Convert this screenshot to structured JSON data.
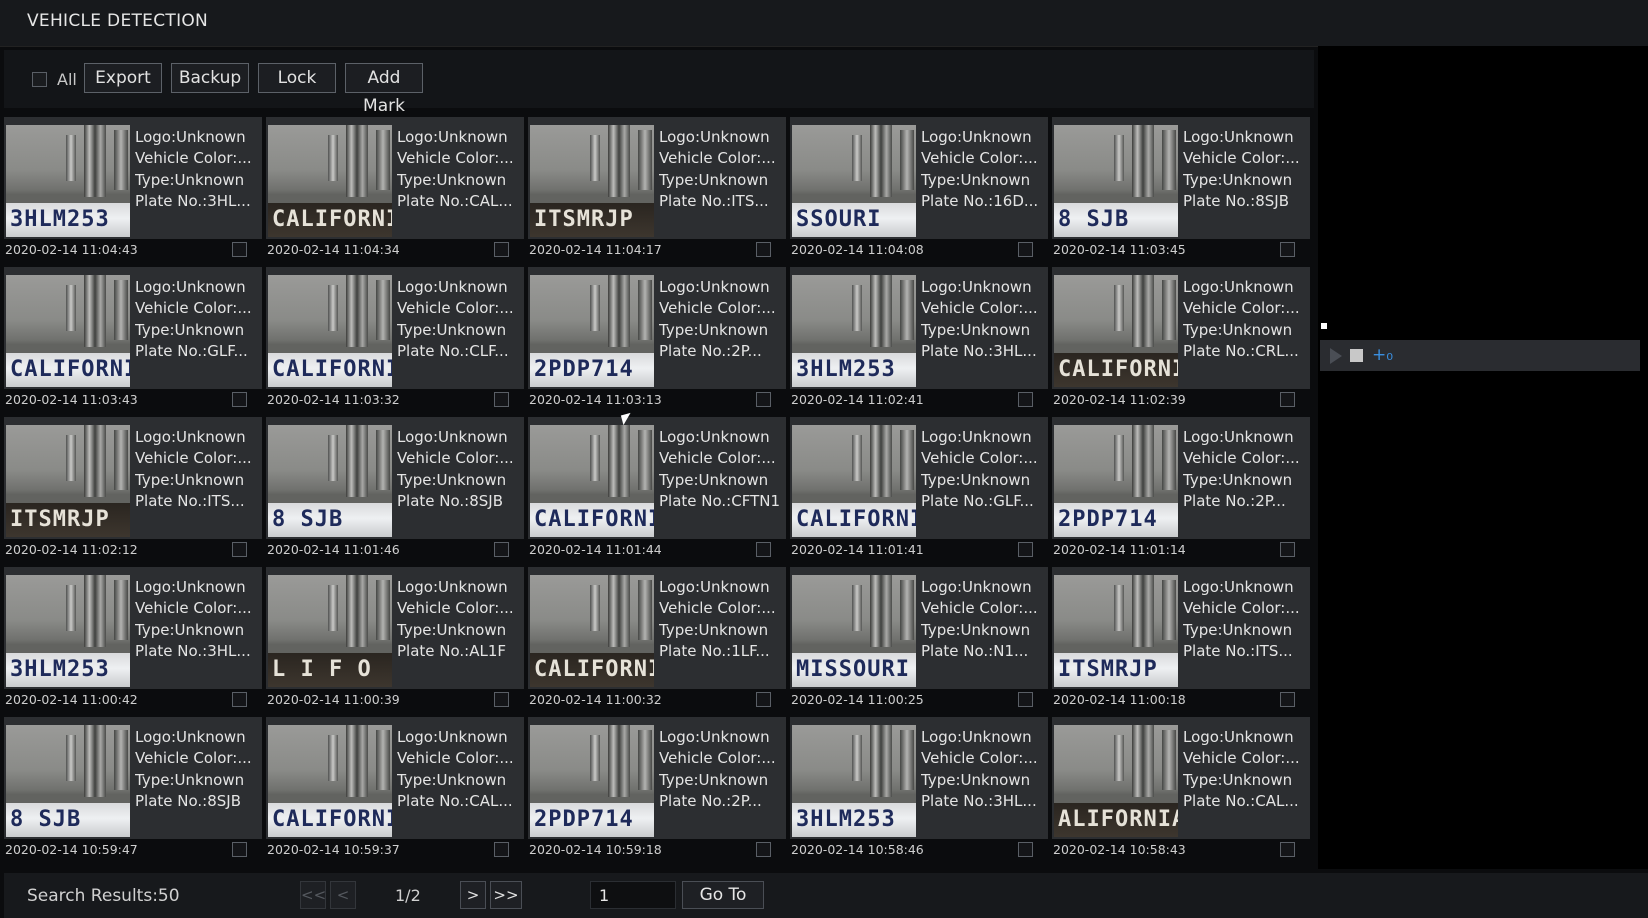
{
  "window": {
    "title": "VEHICLE DETECTION"
  },
  "toolbar": {
    "all_label": "All",
    "export_label": "Export",
    "backup_label": "Backup",
    "lock_label": "Lock",
    "add_mark_label": "Add Mark"
  },
  "records": [
    {
      "logo": "Logo:Unknown",
      "color": "Vehicle Color:...",
      "type": "Type:Unknown",
      "plate": "Plate No.:3HL...",
      "time": "2020-02-14 11:04:43",
      "plate_img": "3HLM253",
      "dark": false
    },
    {
      "logo": "Logo:Unknown",
      "color": "Vehicle Color:...",
      "type": "Type:Unknown",
      "plate": "Plate No.:CAL...",
      "time": "2020-02-14 11:04:34",
      "plate_img": "CALIFORNIA",
      "dark": true
    },
    {
      "logo": "Logo:Unknown",
      "color": "Vehicle Color:...",
      "type": "Type:Unknown",
      "plate": "Plate No.:ITS...",
      "time": "2020-02-14 11:04:17",
      "plate_img": "ITSMRJP",
      "dark": true
    },
    {
      "logo": "Logo:Unknown",
      "color": "Vehicle Color:...",
      "type": "Type:Unknown",
      "plate": "Plate No.:16D...",
      "time": "2020-02-14 11:04:08",
      "plate_img": "SSOURI",
      "dark": false
    },
    {
      "logo": "Logo:Unknown",
      "color": "Vehicle Color:...",
      "type": "Type:Unknown",
      "plate": "Plate No.:8SJB",
      "time": "2020-02-14 11:03:45",
      "plate_img": "8 SJB",
      "dark": false
    },
    {
      "logo": "Logo:Unknown",
      "color": "Vehicle Color:...",
      "type": "Type:Unknown",
      "plate": "Plate No.:GLF...",
      "time": "2020-02-14 11:03:43",
      "plate_img": "CALIFORNIA",
      "dark": false
    },
    {
      "logo": "Logo:Unknown",
      "color": "Vehicle Color:...",
      "type": "Type:Unknown",
      "plate": "Plate No.:CLF...",
      "time": "2020-02-14 11:03:32",
      "plate_img": "CALIFORNIA",
      "dark": false
    },
    {
      "logo": "Logo:Unknown",
      "color": "Vehicle Color:...",
      "type": "Type:Unknown",
      "plate": "Plate No.:2P...",
      "time": "2020-02-14 11:03:13",
      "plate_img": "2PDP714",
      "dark": false
    },
    {
      "logo": "Logo:Unknown",
      "color": "Vehicle Color:...",
      "type": "Type:Unknown",
      "plate": "Plate No.:3HL...",
      "time": "2020-02-14 11:02:41",
      "plate_img": "3HLM253",
      "dark": false
    },
    {
      "logo": "Logo:Unknown",
      "color": "Vehicle Color:...",
      "type": "Type:Unknown",
      "plate": "Plate No.:CRL...",
      "time": "2020-02-14 11:02:39",
      "plate_img": "CALIFORNIA",
      "dark": true
    },
    {
      "logo": "Logo:Unknown",
      "color": "Vehicle Color:...",
      "type": "Type:Unknown",
      "plate": "Plate No.:ITS...",
      "time": "2020-02-14 11:02:12",
      "plate_img": "ITSMRJP",
      "dark": true
    },
    {
      "logo": "Logo:Unknown",
      "color": "Vehicle Color:...",
      "type": "Type:Unknown",
      "plate": "Plate No.:8SJB",
      "time": "2020-02-14 11:01:46",
      "plate_img": "8 SJB",
      "dark": false
    },
    {
      "logo": "Logo:Unknown",
      "color": "Vehicle Color:...",
      "type": "Type:Unknown",
      "plate": "Plate No.:CFTN1",
      "time": "2020-02-14 11:01:44",
      "plate_img": "CALIFORNIA",
      "dark": false
    },
    {
      "logo": "Logo:Unknown",
      "color": "Vehicle Color:...",
      "type": "Type:Unknown",
      "plate": "Plate No.:GLF...",
      "time": "2020-02-14 11:01:41",
      "plate_img": "CALIFORNIA",
      "dark": false
    },
    {
      "logo": "Logo:Unknown",
      "color": "Vehicle Color:...",
      "type": "Type:Unknown",
      "plate": "Plate No.:2P...",
      "time": "2020-02-14 11:01:14",
      "plate_img": "2PDP714",
      "dark": false
    },
    {
      "logo": "Logo:Unknown",
      "color": "Vehicle Color:...",
      "type": "Type:Unknown",
      "plate": "Plate No.:3HL...",
      "time": "2020-02-14 11:00:42",
      "plate_img": "3HLM253",
      "dark": false
    },
    {
      "logo": "Logo:Unknown",
      "color": "Vehicle Color:...",
      "type": "Type:Unknown",
      "plate": "Plate No.:AL1F",
      "time": "2020-02-14 11:00:39",
      "plate_img": "L I F O",
      "dark": true
    },
    {
      "logo": "Logo:Unknown",
      "color": "Vehicle Color:...",
      "type": "Type:Unknown",
      "plate": "Plate No.:1LF...",
      "time": "2020-02-14 11:00:32",
      "plate_img": "CALIFORNIA",
      "dark": true
    },
    {
      "logo": "Logo:Unknown",
      "color": "Vehicle Color:...",
      "type": "Type:Unknown",
      "plate": "Plate No.:N1...",
      "time": "2020-02-14 11:00:25",
      "plate_img": "MISSOURI",
      "dark": false
    },
    {
      "logo": "Logo:Unknown",
      "color": "Vehicle Color:...",
      "type": "Type:Unknown",
      "plate": "Plate No.:ITS...",
      "time": "2020-02-14 11:00:18",
      "plate_img": "ITSMRJP",
      "dark": false
    },
    {
      "logo": "Logo:Unknown",
      "color": "Vehicle Color:...",
      "type": "Type:Unknown",
      "plate": "Plate No.:8SJB",
      "time": "2020-02-14 10:59:47",
      "plate_img": "8 SJB",
      "dark": false
    },
    {
      "logo": "Logo:Unknown",
      "color": "Vehicle Color:...",
      "type": "Type:Unknown",
      "plate": "Plate No.:CAL...",
      "time": "2020-02-14 10:59:37",
      "plate_img": "CALIFORNIA",
      "dark": false
    },
    {
      "logo": "Logo:Unknown",
      "color": "Vehicle Color:...",
      "type": "Type:Unknown",
      "plate": "Plate No.:2P...",
      "time": "2020-02-14 10:59:18",
      "plate_img": "2PDP714",
      "dark": false
    },
    {
      "logo": "Logo:Unknown",
      "color": "Vehicle Color:...",
      "type": "Type:Unknown",
      "plate": "Plate No.:3HL...",
      "time": "2020-02-14 10:58:46",
      "plate_img": "3HLM253",
      "dark": false
    },
    {
      "logo": "Logo:Unknown",
      "color": "Vehicle Color:...",
      "type": "Type:Unknown",
      "plate": "Plate No.:CAL...",
      "time": "2020-02-14 10:58:43",
      "plate_img": "ALIFORNIA",
      "dark": true
    }
  ],
  "player": {
    "play_icon": "play-icon",
    "stop_icon": "stop-icon",
    "clip_icon": "clip-icon",
    "clip_glyph": "+₀"
  },
  "footer": {
    "search_results": "Search Results:50",
    "first_label": "<<",
    "prev_label": "<",
    "page_indicator": "1/2",
    "next_label": ">",
    "last_label": ">>",
    "page_input_value": "1",
    "goto_label": "Go To"
  },
  "colors": {
    "background": "#0b0c0e",
    "card": "#2c2e31",
    "accent": "#3a8fe0"
  }
}
